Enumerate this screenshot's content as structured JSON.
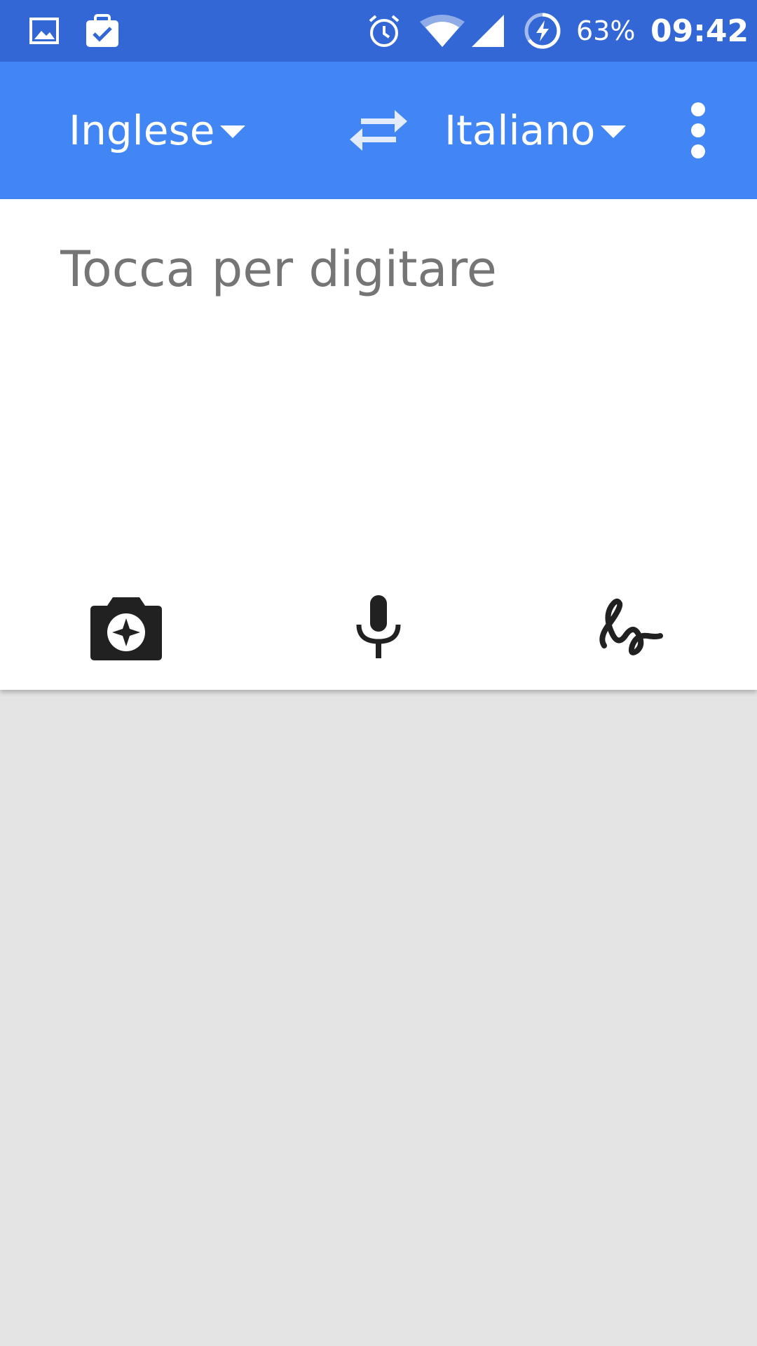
{
  "status_bar": {
    "battery_percent": "63%",
    "time": "09:42",
    "icons": [
      "image-icon",
      "clipboard-check-icon",
      "alarm-icon",
      "wifi-icon",
      "signal-icon",
      "battery-saver-icon"
    ]
  },
  "toolbar": {
    "source_language": "Inglese",
    "target_language": "Italiano",
    "icons": [
      "dropdown-caret-icon",
      "swap-arrows-icon",
      "more-vert-icon"
    ]
  },
  "input": {
    "placeholder": "Tocca per digitare",
    "value": ""
  },
  "tools": {
    "icons": [
      "camera-icon",
      "microphone-icon",
      "handwriting-icon"
    ]
  },
  "colors": {
    "status_bar": "#3367d6",
    "toolbar": "#4285f4",
    "card": "#ffffff",
    "background": "#e4e4e5",
    "placeholder": "#757575",
    "icon_dark": "#212121"
  }
}
